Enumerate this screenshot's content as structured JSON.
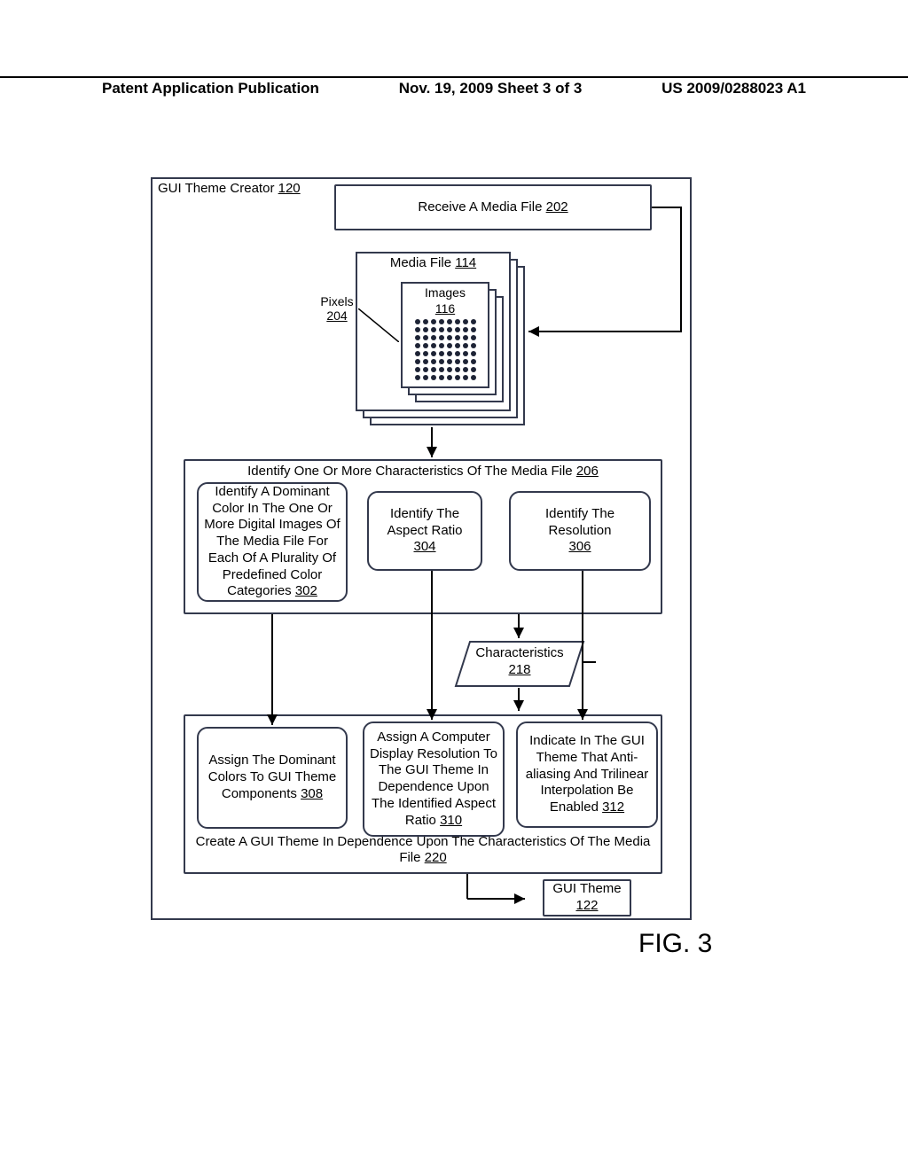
{
  "header": {
    "left": "Patent Application Publication",
    "mid": "Nov. 19, 2009  Sheet 3 of 3",
    "right": "US 2009/0288023 A1"
  },
  "figure_label": "FIG. 3",
  "gui_title_prefix": "GUI Theme Creator",
  "gui_title_ref": "120",
  "boxes": {
    "b202": {
      "text": "Receive A Media File",
      "ref": "202"
    },
    "mediafile": {
      "text": "Media File",
      "ref": "114"
    },
    "images": {
      "text": "Images",
      "ref": "116"
    },
    "pixels": {
      "text": "Pixels",
      "ref": "204"
    },
    "b206": {
      "text": "Identify One Or More Characteristics Of The Media File",
      "ref": "206"
    },
    "b302": {
      "text": "Identify A Dominant Color In The One Or More Digital Images Of The Media File For Each Of A Plurality Of Predefined Color Categories",
      "ref": "302"
    },
    "b304": {
      "text": "Identify The Aspect Ratio",
      "ref": "304"
    },
    "b306": {
      "text": "Identify The Resolution",
      "ref": "306"
    },
    "b218": {
      "text": "Characteristics",
      "ref": "218"
    },
    "b308": {
      "text": "Assign The Dominant Colors To GUI Theme Components",
      "ref": "308"
    },
    "b310": {
      "text": "Assign A Computer Display Resolution To The GUI Theme In Dependence Upon The Identified Aspect Ratio",
      "ref": "310"
    },
    "b312": {
      "text": "Indicate In The GUI Theme That Anti-aliasing And Trilinear Interpolation Be Enabled",
      "ref": "312"
    },
    "b220": {
      "text": "Create A GUI Theme In Dependence Upon The Characteristics Of The Media File",
      "ref": "220"
    },
    "b122": {
      "text": "GUI Theme",
      "ref": "122"
    }
  }
}
